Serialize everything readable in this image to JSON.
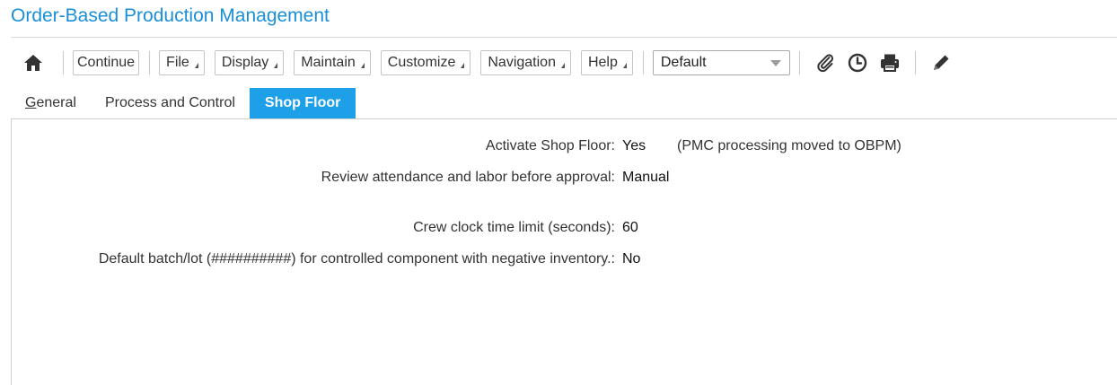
{
  "app": {
    "title": "Order-Based Production Management"
  },
  "toolbar": {
    "home_icon": "home-icon",
    "buttons": {
      "continue": "Continue",
      "file": "File",
      "display": "Display",
      "maintain": "Maintain",
      "customize": "Customize",
      "navigation": "Navigation",
      "help": "Help"
    },
    "view_select": {
      "value": "Default"
    },
    "icons": [
      "paperclip-icon",
      "clock-icon",
      "printer-icon",
      "pencil-icon"
    ]
  },
  "tabs": {
    "general_prefix": "G",
    "general_rest": "eneral",
    "process": "Process and Control",
    "shop_floor": "Shop Floor",
    "active": "Shop Floor"
  },
  "form": {
    "activate_shop_floor": {
      "label": "Activate Shop Floor:",
      "value": "Yes",
      "note": "(PMC processing moved to OBPM)"
    },
    "review_attendance": {
      "label": "Review attendance and labor before approval:",
      "value": "Manual"
    },
    "crew_clock": {
      "label": "Crew clock time limit (seconds):",
      "value": "60"
    },
    "default_batch": {
      "label": "Default batch/lot (##########) for controlled component with negative inventory.:",
      "value": "No"
    }
  },
  "colors": {
    "title": "#1a8fd8",
    "active_tab": "#1ea0e8"
  }
}
